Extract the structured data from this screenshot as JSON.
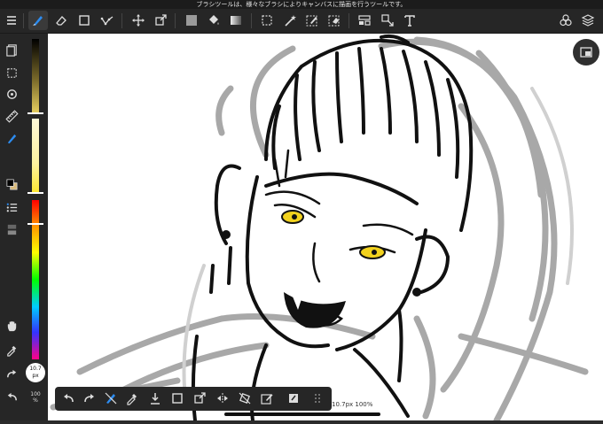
{
  "tooltip": "ブラシツールは、様々なブラシによりキャンバスに描画を行うツールです。",
  "top_toolbar": {
    "icons": [
      "menu-icon",
      "brush-icon",
      "eraser-icon",
      "rectangle-icon",
      "dot-pen-icon",
      "move-icon",
      "transform-icon",
      "fill-color-icon",
      "bucket-icon",
      "gradient-icon",
      "marquee-icon",
      "magic-wand-icon",
      "select-pen-icon",
      "select-eraser-icon",
      "filter-icon",
      "layer-move-icon",
      "text-icon",
      "materials-icon",
      "layers-icon"
    ]
  },
  "brush_size": {
    "value": "10.7",
    "unit": "px"
  },
  "opacity": {
    "value": "100",
    "unit": "%"
  },
  "status_text": "10.7px 100%",
  "colors": {
    "accent": "#2d8cf0",
    "primary": "#000000",
    "secondary": "#d8b97a",
    "eye": "#f2d21e"
  },
  "bottom_toolbar": {
    "icons": [
      "undo-icon",
      "redo-icon",
      "eraser-brush-icon",
      "eyedropper-icon",
      "save-icon",
      "select-all-icon",
      "transform-icon",
      "flip-icon",
      "rotate-icon",
      "edit-icon",
      "clear-icon",
      "more-icon"
    ]
  }
}
